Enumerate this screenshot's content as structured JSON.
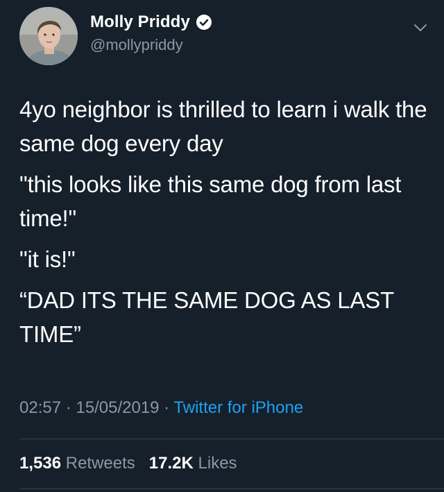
{
  "theme": {
    "background": "#15202b",
    "text_primary": "#ffffff",
    "text_secondary": "#8899a6",
    "accent": "#1da1f2",
    "divider": "#38444d"
  },
  "author": {
    "display_name": "Molly Priddy",
    "handle": "@mollypriddy",
    "verified": true,
    "verified_icon": "verified-badge-icon",
    "avatar_icon": "profile-photo"
  },
  "menu_icon": "chevron-down-icon",
  "tweet": {
    "paragraphs": [
      "4yo neighbor is thrilled to learn i walk the same dog every day",
      "\"this looks like this same dog from last time!\"",
      "\"it is!\"",
      "“DAD ITS THE SAME DOG AS LAST TIME”"
    ]
  },
  "meta": {
    "time": "02:57",
    "separator": " · ",
    "date": "15/05/2019",
    "source": "Twitter for iPhone"
  },
  "stats": {
    "retweets_count": "1,536",
    "retweets_label": "Retweets",
    "likes_count": "17.2K",
    "likes_label": "Likes"
  }
}
